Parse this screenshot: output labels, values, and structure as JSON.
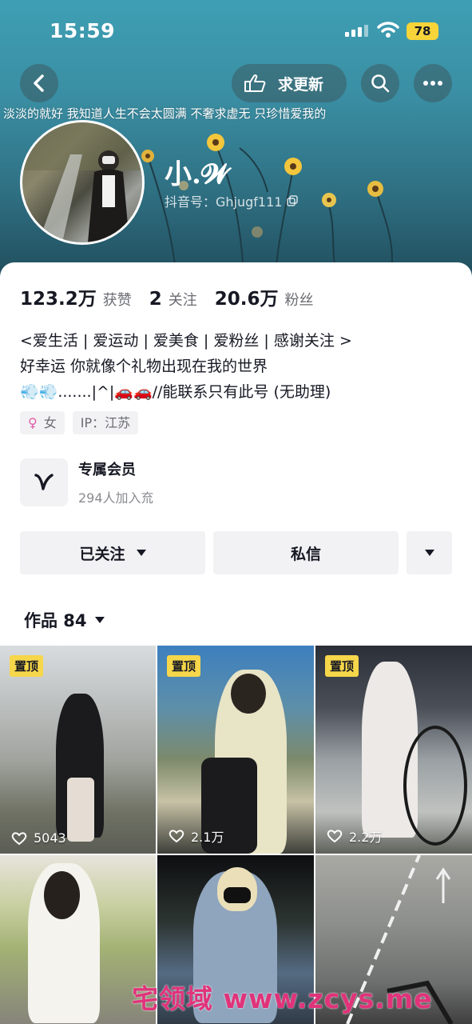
{
  "status_bar": {
    "time": "15:59",
    "battery": "78"
  },
  "header": {
    "update_button_label": "求更新",
    "banner_quote": "淡淡的就好 我知道人生不会太圆满 不奢求虚无 只珍惜爱我的",
    "display_name": "小.𝓦",
    "douyin_id": "抖音号：Ghjugf111"
  },
  "stats": [
    {
      "value": "123.2万",
      "label": "获赞"
    },
    {
      "value": "2",
      "label": "关注"
    },
    {
      "value": "20.6万",
      "label": "粉丝"
    }
  ],
  "bio": {
    "line1": "<爱生活 | 爱运动 |  爱美食 | 爱粉丝 | 感谢关注 >",
    "line2": "好幸运 你就像个礼物出现在我的世界",
    "line3": "💨💨.......|^|🚗🚗//能联系只有此号 (无助理)"
  },
  "tags": {
    "gender_symbol": "♀",
    "gender": "女",
    "ip": "IP：江苏"
  },
  "membership": {
    "title": "专属会员",
    "subtitle": "294人加入㐬"
  },
  "actions": {
    "followed_label": "已关注",
    "message_label": "私信"
  },
  "works_tab": {
    "label": "作品 84"
  },
  "videos": [
    {
      "pinned": "置顶",
      "likes": "5043"
    },
    {
      "pinned": "置顶",
      "likes": "2.1万"
    },
    {
      "pinned": "置顶",
      "likes": "2.2万"
    },
    {},
    {},
    {}
  ],
  "watermark": "宅领域 www.zcys.me",
  "colors": {
    "pin_badge": "#f6d64a",
    "banner": "#3a8ea3",
    "watermark": "#e0337a"
  }
}
